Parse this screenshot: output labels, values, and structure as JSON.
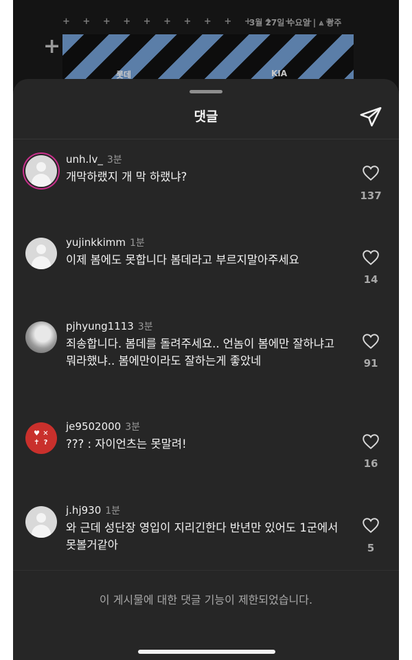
{
  "background_post": {
    "plus_row": "+ + + + + + + + + + + + + +",
    "date_text": "3월 27일 수요일 | ⩓ 광주",
    "big_plus": "+",
    "banner_word_left": "롯데",
    "banner_word_right": "KIA"
  },
  "sheet": {
    "title": "댓글",
    "share_icon": "send-paper-plane-icon"
  },
  "comments": [
    {
      "username": "unh.lv_",
      "time": "3분",
      "text": "개막하랬지 개 막 하랬냐?",
      "likes": "137",
      "avatar": "default-with-story-ring"
    },
    {
      "username": "yujinkkimm",
      "time": "1분",
      "text": "이제 봄에도 못합니다 봄데라고 부르지말아주세요",
      "likes": "14",
      "avatar": "default"
    },
    {
      "username": "pjhyung1113",
      "time": "3분",
      "text": "죄송합니다. 봄데를 돌려주세요.. 언놈이 봄에만 잘하냐고 뭐라했냐.. 봄에만이라도 잘하는게 좋았네",
      "likes": "91",
      "avatar": "photo"
    },
    {
      "username": "je9502000",
      "time": "3분",
      "text": "??? : 자이언츠는 못말려!",
      "likes": "16",
      "avatar": "red-icons"
    },
    {
      "username": "j.hj930",
      "time": "1분",
      "text": "와 근데 성단장 영입이 지리긴한다 반년만 있어도 1군에서 못볼거같아",
      "likes": "5",
      "avatar": "default"
    }
  ],
  "avatar_icon_glyphs": [
    "♥",
    "✕",
    "✝",
    "?"
  ],
  "footer": {
    "restricted_notice": "이 게시물에 대한 댓글 기능이 제한되었습니다."
  },
  "colors": {
    "sheet_bg": "#262626",
    "story_ring": "#c9308c",
    "text_primary": "#f2f2f2",
    "text_secondary": "#a8a8a8"
  }
}
